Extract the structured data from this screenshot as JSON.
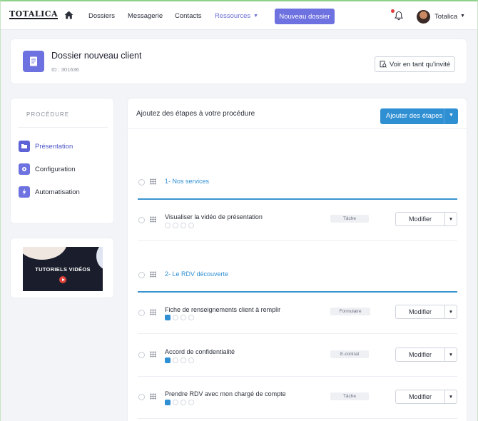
{
  "nav": {
    "logo": "TOTALICA",
    "links": [
      "Dossiers",
      "Messagerie",
      "Contacts",
      "Ressources"
    ],
    "new_button": "Nouveau dossier",
    "user_name": "Totalica"
  },
  "header": {
    "title": "Dossier nouveau client",
    "id_text": "ID : 301636",
    "guest_button": "Voir en tant qu'invité"
  },
  "procedure": {
    "title": "PROCÉDURE",
    "items": [
      {
        "label": "Présentation",
        "icon": "folder-icon",
        "active": true
      },
      {
        "label": "Configuration",
        "icon": "gear-icon",
        "active": false
      },
      {
        "label": "Automatisation",
        "icon": "bolt-icon",
        "active": false
      }
    ]
  },
  "tutorial": {
    "label": "TUTORIELS VIDÉOS"
  },
  "main": {
    "title": "Ajoutez des étapes à votre procédure",
    "add_button": "Ajouter des étapes",
    "modify_label": "Modifier",
    "sections": [
      {
        "title": "1- Nos services",
        "steps": [
          {
            "title": "Visualiser la vidéo de présentation",
            "tag": "Tâche"
          }
        ]
      },
      {
        "title": "2- Le RDV découverte",
        "steps": [
          {
            "title": "Fiche de renseignements client à remplir",
            "tag": "Formulaire"
          },
          {
            "title": "Accord de confidentialité",
            "tag": "E-contrat"
          },
          {
            "title": "Prendre RDV avec mon chargé de compte",
            "tag": "Tâche"
          }
        ]
      }
    ]
  },
  "colors": {
    "accent": "#6e72e0",
    "primary_blue": "#2f8fd3",
    "notification": "#e23b3b"
  }
}
